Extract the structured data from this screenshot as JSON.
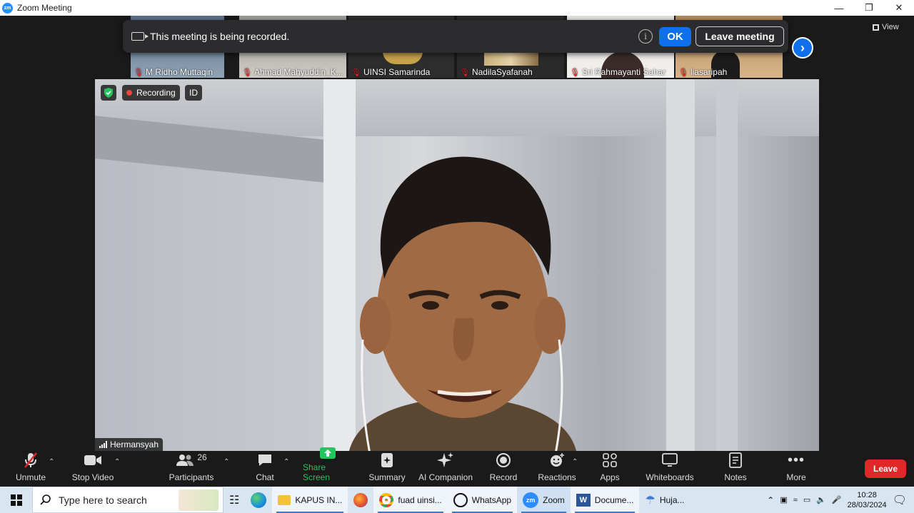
{
  "window": {
    "title": "Zoom Meeting",
    "app_icon_text": "zm"
  },
  "recording_banner": {
    "message": "This meeting is being recorded.",
    "ok_label": "OK",
    "leave_meeting_label": "Leave meeting"
  },
  "view_label": "View",
  "participants_strip": [
    {
      "name": "M Ridho Muttaqin",
      "muted": true
    },
    {
      "name": "Ahmad Mahyuddin_K...",
      "muted": true
    },
    {
      "name": "UINSI Samarinda",
      "muted": true
    },
    {
      "name": "NadilaSyafanah",
      "muted": true
    },
    {
      "name": "Sri Rahmayanti Sahar",
      "muted": true
    },
    {
      "name": "liasaripah",
      "muted": true
    }
  ],
  "main_video": {
    "recording_label": "Recording",
    "id_label": "ID",
    "speaker_name": "Hermansyah"
  },
  "toolbar": {
    "unmute": "Unmute",
    "stop_video": "Stop Video",
    "participants": "Participants",
    "participants_count": "26",
    "chat": "Chat",
    "share_screen": "Share Screen",
    "summary": "Summary",
    "ai_companion": "AI Companion",
    "record": "Record",
    "reactions": "Reactions",
    "apps": "Apps",
    "whiteboards": "Whiteboards",
    "notes": "Notes",
    "more": "More",
    "leave": "Leave"
  },
  "colors": {
    "accent": "#0e71eb",
    "leave_red": "#e02828",
    "share_green": "#22c55e",
    "recording_dot": "#f0443a"
  },
  "taskbar": {
    "search_placeholder": "Type here to search",
    "apps": [
      {
        "label": "KAPUS IN...",
        "icon": "folder-icon"
      },
      {
        "label": "fuad uinsi...",
        "icon": "chrome-icon"
      },
      {
        "label": "WhatsApp",
        "icon": "whatsapp-icon"
      },
      {
        "label": "Zoom",
        "icon": "zoom-icon"
      },
      {
        "label": "Docume...",
        "icon": "word-icon"
      },
      {
        "label": "Huja...",
        "icon": "weather-icon"
      }
    ],
    "time": "10:28",
    "date": "28/03/2024"
  }
}
